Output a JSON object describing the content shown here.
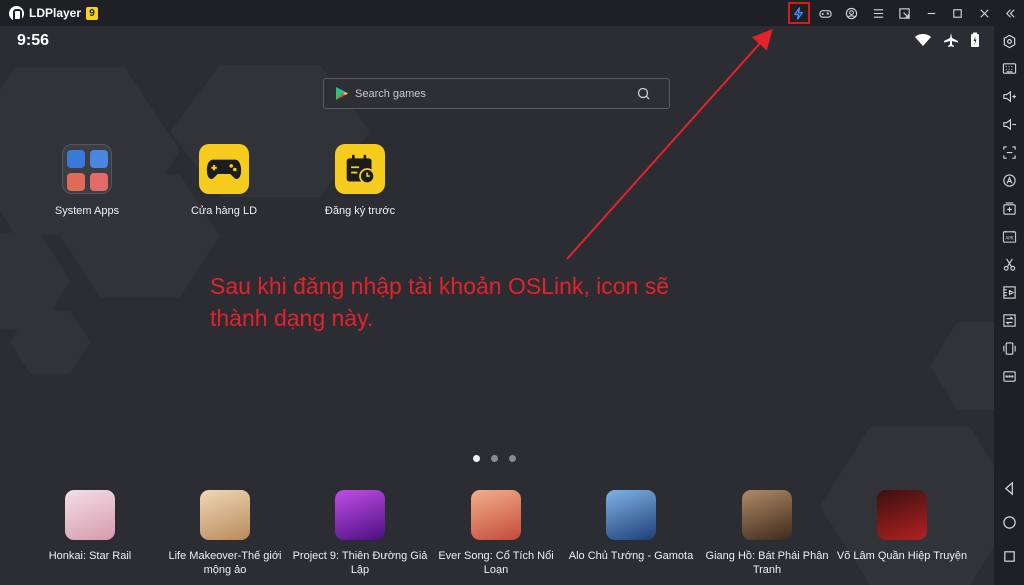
{
  "window": {
    "title": "LDPlayer",
    "version_badge": "9"
  },
  "statusbar": {
    "time": "9:56"
  },
  "search": {
    "placeholder": "Search games"
  },
  "home_apps": [
    {
      "label": "System Apps"
    },
    {
      "label": "Cửa hàng LD"
    },
    {
      "label": "Đăng ký trước"
    }
  ],
  "annotation": {
    "line1": "Sau khi đăng nhập tài khoản OSLink, icon sẽ",
    "line2": "thành dạng này."
  },
  "pager": {
    "count": 3,
    "active": 1
  },
  "dock_apps": [
    {
      "label": "Honkai: Star Rail",
      "color": "#e9c7cf"
    },
    {
      "label": "Life Makeover-Thế giới mộng ảo",
      "color": "#d8b48c"
    },
    {
      "label": "Project 9: Thiên Đường Giả Lập",
      "color": "#8c2bd0"
    },
    {
      "label": "Ever Song: Cổ Tích Nổi Loạn",
      "color": "#e3805e"
    },
    {
      "label": "Alo Chủ Tướng - Gamota",
      "color": "#3b6fb0"
    },
    {
      "label": "Giang Hồ: Bát Phái Phân Tranh",
      "color": "#6b4a32"
    },
    {
      "label": "Võ Lâm Quần Hiệp Truyện",
      "color": "#8a1c1c"
    }
  ],
  "colors": {
    "accent_highlight": "#e0161b",
    "annotation": "#e3222b",
    "oslink_icon": "#4b8dff",
    "store_yellow": "#f6cd1e"
  }
}
